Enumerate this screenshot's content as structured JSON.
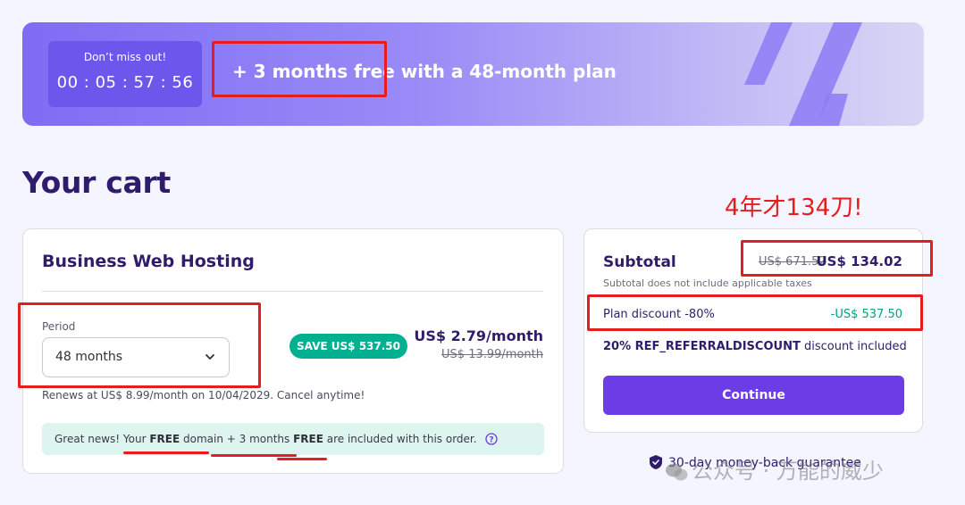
{
  "banner": {
    "countdown_label": "Don’t miss out!",
    "countdown_time": "00 : 05 : 57 : 56",
    "promo_text": "+ 3 months free with a 48-month plan"
  },
  "cart": {
    "title": "Your cart",
    "product": {
      "name": "Business Web Hosting",
      "period_label": "Period",
      "period_value": "48 months",
      "save_badge": "SAVE US$ 537.50",
      "price_now": "US$ 2.79/month",
      "price_old": "US$ 13.99/month",
      "renew_text": "Renews at US$ 8.99/month on 10/04/2029. Cancel anytime!",
      "info": {
        "part1": "Great news! Your ",
        "bold1": "FREE",
        "part2": " domain + 3 months ",
        "bold2": "FREE",
        "part3": " are included with this order."
      }
    }
  },
  "summary": {
    "subtotal_label": "Subtotal",
    "subtotal_old": "US$ 671.52",
    "subtotal_new": "US$ 134.02",
    "tax_note": "Subtotal does not include applicable taxes",
    "plan_discount_label": "Plan discount -80%",
    "plan_discount_value": "-US$ 537.50",
    "ref_code": "20% REF_REFERRALDISCOUNT",
    "ref_suffix": " discount included",
    "continue_label": "Continue"
  },
  "guarantee": "30-day money-back guarantee",
  "annotation": "4年才134刀!",
  "watermark": "公众号 · 万能的威少",
  "colors": {
    "accent": "#6c3ce6",
    "save_green": "#00b090",
    "annotation_red": "#e41e1e",
    "title": "#2f1c6a"
  }
}
